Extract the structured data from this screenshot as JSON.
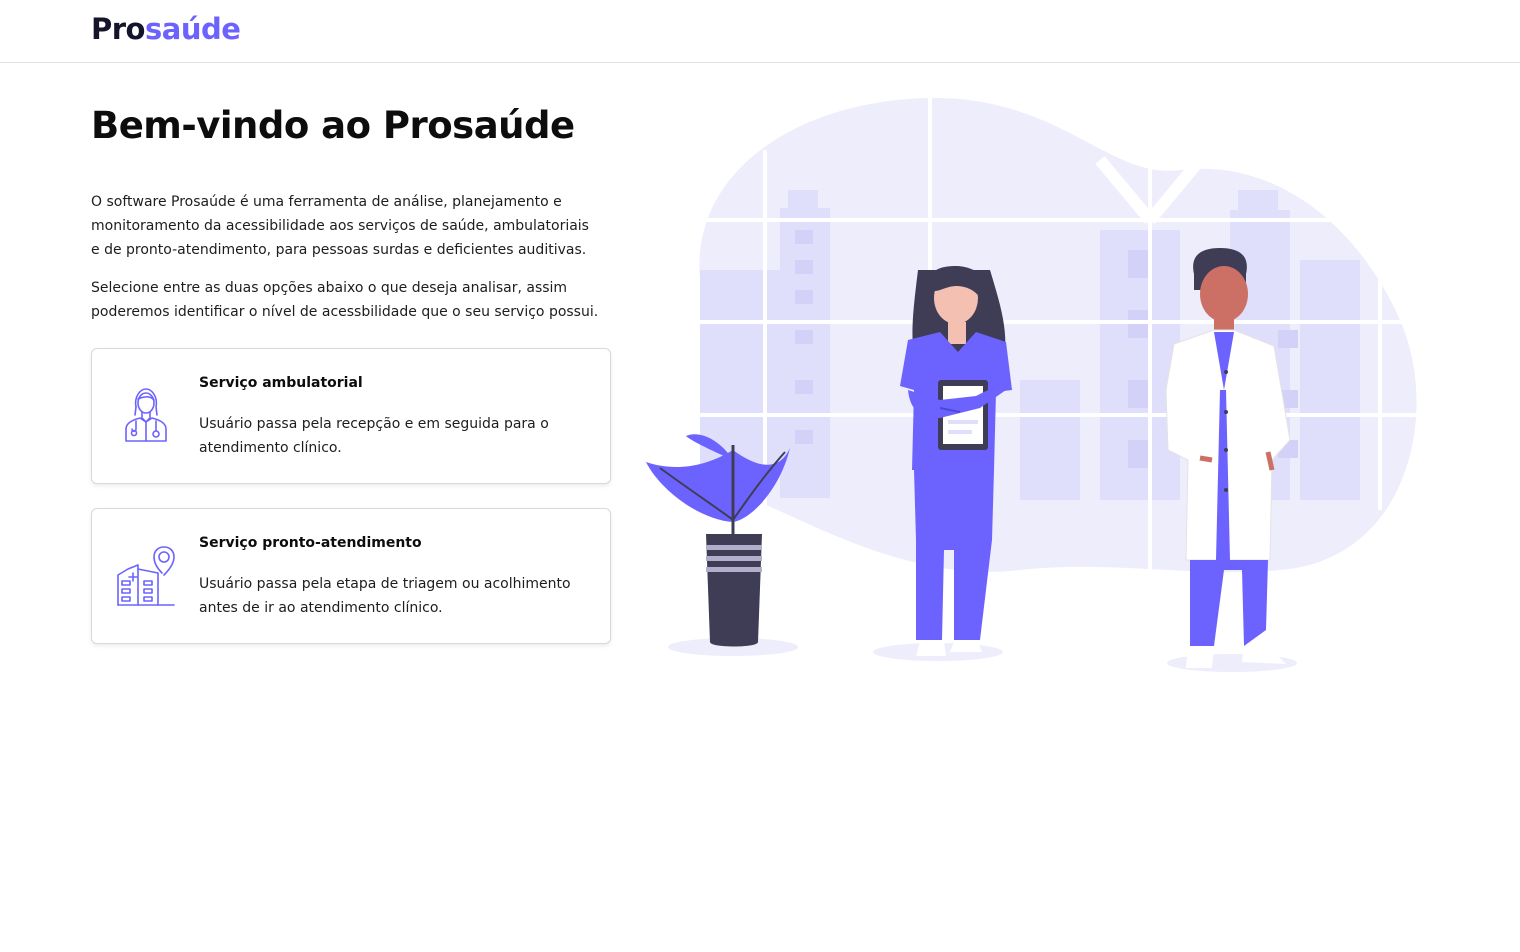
{
  "header": {
    "logo_part1": "Pro",
    "logo_part2": "saúde"
  },
  "main": {
    "title": "Bem-vindo ao Prosaúde",
    "intro": "O software Prosaúde é uma ferramenta de análise, planejamento e monitoramento da acessibilidade aos serviços de saúde, ambulatoriais e de pronto-atendimento, para pessoas surdas e deficientes auditivas.",
    "instruction": "Selecione entre as duas opções abaixo o que deseja analisar, assim poderemos identificar o nível de acessbilidade que o seu serviço possui.",
    "options": [
      {
        "title": "Serviço ambulatorial",
        "description": "Usuário passa pela recepção e em seguida para o atendimento clínico.",
        "icon": "doctor-icon"
      },
      {
        "title": "Serviço pronto-atendimento",
        "description": "Usuário passa pela etapa de triagem ou acolhimento antes de ir ao atendimento clínico.",
        "icon": "hospital-location-icon"
      }
    ]
  },
  "colors": {
    "accent": "#6c63ff",
    "accent_light": "#eeedfc",
    "dark": "#3f3d56",
    "text": "#111111"
  }
}
